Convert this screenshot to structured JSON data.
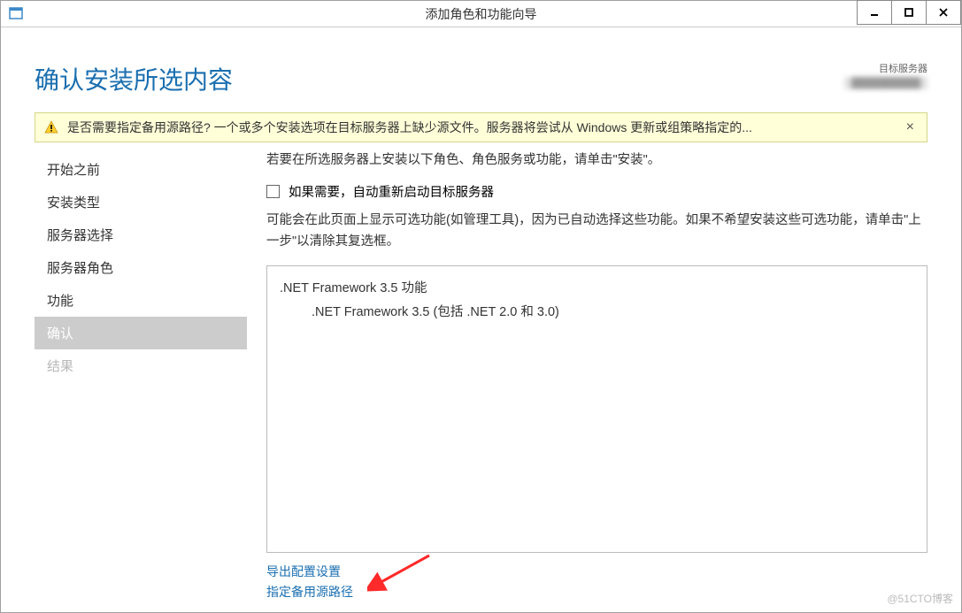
{
  "window": {
    "title": "添加角色和功能向导"
  },
  "header": {
    "page_title": "确认安装所选内容",
    "target_server_label": "目标服务器",
    "target_server_value": "██████████"
  },
  "notification": {
    "text": "是否需要指定备用源路径? 一个或多个安装选项在目标服务器上缺少源文件。服务器将尝试从 Windows 更新或组策略指定的...",
    "close": "×"
  },
  "sidebar": {
    "items": [
      {
        "label": "开始之前",
        "state": "normal"
      },
      {
        "label": "安装类型",
        "state": "normal"
      },
      {
        "label": "服务器选择",
        "state": "normal"
      },
      {
        "label": "服务器角色",
        "state": "normal"
      },
      {
        "label": "功能",
        "state": "normal"
      },
      {
        "label": "确认",
        "state": "active"
      },
      {
        "label": "结果",
        "state": "disabled"
      }
    ]
  },
  "main": {
    "instruction": "若要在所选服务器上安装以下角色、角色服务或功能，请单击\"安装\"。",
    "checkbox_label": "如果需要，自动重新启动目标服务器",
    "note": "可能会在此页面上显示可选功能(如管理工具)，因为已自动选择这些功能。如果不希望安装这些可选功能，请单击\"上一步\"以清除其复选框。",
    "features": {
      "parent": ".NET Framework 3.5 功能",
      "child": ".NET Framework 3.5 (包括 .NET 2.0 和 3.0)"
    },
    "links": {
      "export": "导出配置设置",
      "alt_source": "指定备用源路径"
    }
  },
  "watermark": "@51CTO博客"
}
